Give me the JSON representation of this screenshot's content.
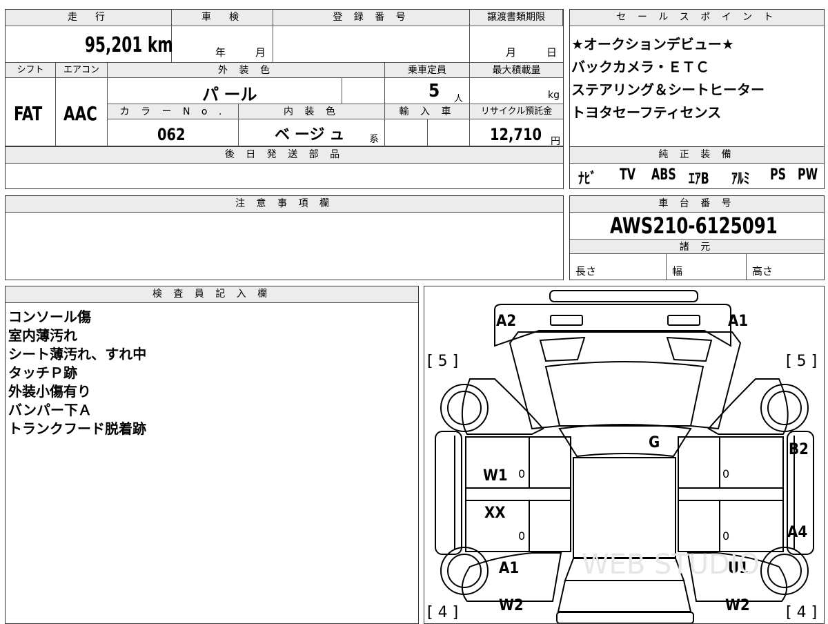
{
  "top": {
    "headers": {
      "mileage": "走　行",
      "inspection": "車　検",
      "registration": "登 録 番 号",
      "transfer_deadline": "譲渡書類期限",
      "sales_points": "セ ー ル ス ポ イ ン ト",
      "shift": "シフト",
      "aircon": "エアコン",
      "exterior_color": "外 装 色",
      "capacity": "乗車定員",
      "max_load": "最大積載量",
      "color_no": "カ ラ ー N o .",
      "interior_color": "内 装 色",
      "import": "輸 入 車",
      "recycle": "リサイクル預託金",
      "later_parts": "後 日 発 送 部 品",
      "genuine_equipment": "純 正 装 備",
      "notes": "注 意 事 項 欄",
      "chassis_no": "車 台 番 号",
      "specs": "諸 元",
      "inspector_notes": "検 査 員 記 入 欄"
    },
    "mileage": "95,201 km",
    "inspection_year": "年",
    "inspection_month": "月",
    "transfer_month": "月",
    "transfer_day": "日",
    "shift": "FAT",
    "aircon": "AAC",
    "exterior_color": "パ ール",
    "capacity": "5",
    "capacity_unit": "人",
    "max_load_unit": "kg",
    "color_no": "062",
    "interior_color": "ベ ージ ュ",
    "interior_suffix": "系",
    "recycle_fee": "12,710",
    "recycle_unit": "円",
    "sales_points": [
      "★オークションデビュー★",
      "バックカメラ・ＥＴＣ",
      "ステアリング＆シートヒーター",
      "トヨタセーフティセンス"
    ],
    "equipment": [
      "ﾅﾋﾞ",
      "TV",
      "ABS",
      "ｴｱB",
      "ｱﾙﾐ",
      "PS",
      "PW"
    ],
    "chassis_no": "AWS210-6125091",
    "spec_labels": [
      "長さ",
      "幅",
      "高さ"
    ]
  },
  "inspector_notes": [
    "コンソール傷",
    "室内薄汚れ",
    "シート薄汚れ、すれ中",
    "タッチＰ跡",
    "外装小傷有り",
    "バンパー下Ａ",
    "トランクフード脱着跡"
  ],
  "diagram": {
    "marks": {
      "a2": "A2",
      "a1_top": "A1",
      "g": "G",
      "b2": "B2",
      "w1": "W1",
      "xx": "XX",
      "a4": "A4",
      "a1_bottom": "A1",
      "u1": "U1",
      "w2_left": "W2",
      "w2_right": "W2"
    },
    "tires": {
      "front_left": "[ 5 ]",
      "front_right": "[ 5 ]",
      "rear_left": "[ 4 ]",
      "rear_right": "[ 4 ]"
    },
    "zeros": [
      "0",
      "0",
      "0",
      "0"
    ],
    "watermark": "WEB STUDIO"
  }
}
